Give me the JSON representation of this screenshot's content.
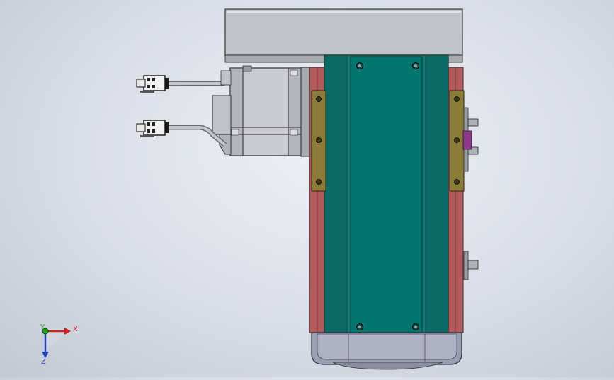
{
  "viewport": {
    "background_top": "#eef1f6",
    "background_bottom": "#c4c8d2"
  },
  "triad": {
    "x_label": "X",
    "y_label": "Y",
    "z_label": "Z",
    "x_color": "#d02020",
    "y_color": "#20a020",
    "z_color": "#2040c0"
  },
  "model": {
    "top_plate_color": "#bfc0c4",
    "rail_color": "#00766f",
    "side_strip_color": "#b45c5c",
    "bracket_color": "#8a7a3a",
    "motor_color": "#c8cacd",
    "end_cap_color": "#9a9eb0",
    "cable_color": "#b8babd",
    "highlight_color": "#8b3a8b"
  }
}
